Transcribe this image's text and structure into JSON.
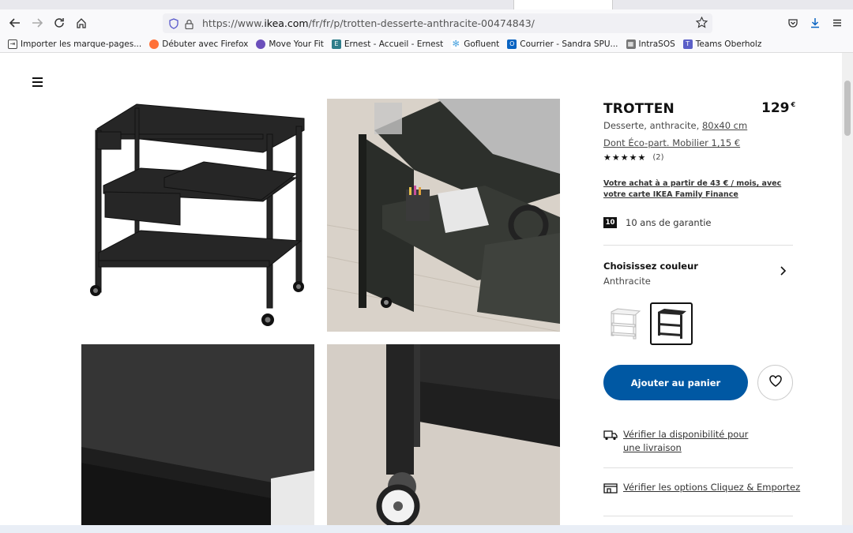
{
  "browser": {
    "url_prefix": "https://www.",
    "url_domain": "ikea.com",
    "url_path": "/fr/fr/p/trotten-desserte-anthracite-00474843/"
  },
  "bookmarks": [
    {
      "label": "Importer les marque-pages...",
      "icon": "import-icon",
      "color": "#444"
    },
    {
      "label": "Débuter avec Firefox",
      "icon": "firefox-icon",
      "color": "#ff7139"
    },
    {
      "label": "Move Your Fit",
      "icon": "fit-icon",
      "color": "#6b4fbb"
    },
    {
      "label": "Ernest - Accueil - Ernest",
      "icon": "ernest-icon",
      "color": "#2e7d8a"
    },
    {
      "label": "Gofluent",
      "icon": "gofluent-icon",
      "color": "#4aa3df"
    },
    {
      "label": "Courrier - Sandra SPU...",
      "icon": "outlook-icon",
      "color": "#0a64c2"
    },
    {
      "label": "IntraSOS",
      "icon": "intrasos-icon",
      "color": "#555"
    },
    {
      "label": "Teams Oberholz",
      "icon": "teams-icon",
      "color": "#5b5fc7"
    }
  ],
  "product": {
    "name": "TROTTEN",
    "price": "129",
    "currency": "€",
    "description": "Desserte, anthracite, ",
    "size": "80x40 cm",
    "eco": "Dont Éco-part. Mobilier 1,15 €",
    "stars": "★★★★★",
    "rating_count": "(2)",
    "finance": "Votre achat à a partir de 43 € / mois, avec votre carte IKEA Family Finance",
    "warranty_years": "10",
    "warranty_text": "10 ans de garantie",
    "color_heading": "Choisissez couleur",
    "color_value": "Anthracite",
    "add_to_cart": "Ajouter au panier",
    "options": [
      {
        "label": "Vérifier la disponibilité pour une livraison",
        "icon": "truck-icon"
      },
      {
        "label": "Vérifier les options Cliquez & Emportez",
        "icon": "store-icon"
      }
    ]
  },
  "colors": {
    "ikea_blue": "#0058a3",
    "product_dark": "#2b2b2b"
  }
}
